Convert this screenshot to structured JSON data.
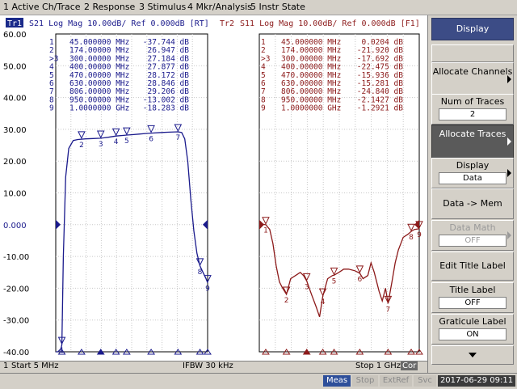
{
  "menu": [
    "1 Active Ch/Trace",
    "2 Response",
    "3 Stimulus",
    "4 Mkr/Analysis",
    "5 Instr State"
  ],
  "trace1": {
    "tag": "Tr1",
    "header": "S21  Log Mag 10.00dB/ Ref 0.000dB [RT]",
    "color": "#1a1a8c",
    "ref_label": "0.000",
    "yticks": [
      "60.00",
      "50.00",
      "40.00",
      "30.00",
      "20.00",
      "10.00",
      "0.000",
      "-10.00",
      "-20.00",
      "-30.00",
      "-40.00"
    ],
    "marker_table": [
      {
        "n": "1",
        "freq": "45.000000 MHz",
        "val": "-37.744 dB"
      },
      {
        "n": "2",
        "freq": "174.00000 MHz",
        "val": "26.947 dB"
      },
      {
        "n": ">3",
        "freq": "300.00000 MHz",
        "val": "27.184 dB"
      },
      {
        "n": "4",
        "freq": "400.00000 MHz",
        "val": "27.877 dB"
      },
      {
        "n": "5",
        "freq": "470.00000 MHz",
        "val": "28.172 dB"
      },
      {
        "n": "6",
        "freq": "630.00000 MHz",
        "val": "28.846 dB"
      },
      {
        "n": "7",
        "freq": "806.00000 MHz",
        "val": "29.206 dB"
      },
      {
        "n": "8",
        "freq": "950.00000 MHz",
        "val": "-13.002 dB"
      },
      {
        "n": "9",
        "freq": "1.0000000 GHz",
        "val": "-18.283 dB"
      }
    ]
  },
  "trace2": {
    "tag": "Tr2",
    "header": "S11  Log Mag 10.00dB/ Ref 0.000dB [F1]",
    "color": "#8c1a1a",
    "marker_table": [
      {
        "n": "1",
        "freq": "45.000000 MHz",
        "val": "0.0204 dB"
      },
      {
        "n": "2",
        "freq": "174.00000 MHz",
        "val": "-21.920 dB"
      },
      {
        "n": ">3",
        "freq": "300.00000 MHz",
        "val": "-17.692 dB"
      },
      {
        "n": "4",
        "freq": "400.00000 MHz",
        "val": "-22.475 dB"
      },
      {
        "n": "5",
        "freq": "470.00000 MHz",
        "val": "-15.936 dB"
      },
      {
        "n": "6",
        "freq": "630.00000 MHz",
        "val": "-15.281 dB"
      },
      {
        "n": "7",
        "freq": "806.00000 MHz",
        "val": "-24.840 dB"
      },
      {
        "n": "8",
        "freq": "950.00000 MHz",
        "val": "-2.1427 dB"
      },
      {
        "n": "9",
        "freq": "1.0000000 GHz",
        "val": "-1.2921 dB"
      }
    ]
  },
  "status": {
    "channel": "1",
    "start": "Start 5 MHz",
    "ifbw": "IFBW 30 kHz",
    "stop": "Stop 1 GHz",
    "cor": "Cor"
  },
  "bottom": {
    "meas": "Meas",
    "stop": "Stop",
    "extref": "ExtRef",
    "svc": "Svc",
    "datetime": "2017-06-29 09:11"
  },
  "softkeys": {
    "title": "Display",
    "allocate_channels": "Allocate Channels",
    "num_traces_label": "Num of Traces",
    "num_traces_value": "2",
    "allocate_traces": "Allocate Traces",
    "display_label": "Display",
    "display_value": "Data",
    "data_mem": "Data -> Mem",
    "data_math_label": "Data Math",
    "data_math_value": "OFF",
    "edit_title": "Edit Title Label",
    "title_label": "Title Label",
    "title_label_value": "OFF",
    "graticule_label": "Graticule Label",
    "graticule_value": "ON"
  },
  "chart_data": [
    {
      "type": "line",
      "title": "S21  Log Mag 10.00dB/ Ref 0.000dB",
      "xlabel": "",
      "ylabel": "",
      "xlim": [
        5,
        1000
      ],
      "ylim": [
        -40,
        60
      ],
      "grid": true,
      "series": [
        {
          "x": [
            5,
            20,
            40,
            45,
            55,
            70,
            90,
            120,
            150,
            174,
            200,
            250,
            300,
            350,
            400,
            450,
            470,
            500,
            550,
            600,
            630,
            700,
            750,
            806,
            830,
            850,
            870,
            890,
            910,
            930,
            950,
            970,
            990,
            1000
          ],
          "y": [
            -40,
            -40,
            -39,
            -37.7,
            -10,
            15,
            24,
            26.5,
            26.8,
            26.9,
            27,
            27.1,
            27.2,
            27.5,
            27.9,
            28.1,
            28.2,
            28.3,
            28.5,
            28.7,
            28.8,
            29,
            29.1,
            29.2,
            29,
            27,
            20,
            8,
            -2,
            -9,
            -13,
            -15,
            -17,
            -18.3
          ]
        }
      ],
      "markers": [
        {
          "n": "1",
          "x": 45,
          "y": -37.744
        },
        {
          "n": "2",
          "x": 174,
          "y": 26.947
        },
        {
          "n": "3",
          "x": 300,
          "y": 27.184
        },
        {
          "n": "4",
          "x": 400,
          "y": 27.877
        },
        {
          "n": "5",
          "x": 470,
          "y": 28.172
        },
        {
          "n": "6",
          "x": 630,
          "y": 28.846
        },
        {
          "n": "7",
          "x": 806,
          "y": 29.206
        },
        {
          "n": "8",
          "x": 950,
          "y": -13.002
        },
        {
          "n": "9",
          "x": 1000,
          "y": -18.283
        }
      ]
    },
    {
      "type": "line",
      "title": "S11  Log Mag 10.00dB/ Ref 0.000dB",
      "xlabel": "",
      "ylabel": "",
      "xlim": [
        5,
        1000
      ],
      "ylim": [
        -40,
        60
      ],
      "grid": true,
      "series": [
        {
          "x": [
            5,
            20,
            45,
            70,
            90,
            110,
            130,
            150,
            174,
            200,
            230,
            260,
            280,
            300,
            330,
            360,
            380,
            400,
            430,
            460,
            470,
            500,
            530,
            560,
            600,
            630,
            650,
            680,
            700,
            720,
            750,
            770,
            790,
            806,
            830,
            850,
            870,
            900,
            930,
            950,
            970,
            1000
          ],
          "y": [
            0,
            0.2,
            0,
            -1.5,
            -6,
            -13,
            -18,
            -20,
            -21.9,
            -17,
            -16,
            -15,
            -16,
            -17.7,
            -22,
            -26,
            -29,
            -22.5,
            -17,
            -16,
            -15.9,
            -15,
            -14,
            -14,
            -14.5,
            -15.3,
            -17,
            -16,
            -12,
            -15,
            -21,
            -24,
            -20,
            -24.8,
            -18,
            -12,
            -8,
            -4,
            -3,
            -2.1,
            -1.5,
            -1.3
          ]
        }
      ],
      "markers": [
        {
          "n": "1",
          "x": 45,
          "y": 0.0204
        },
        {
          "n": "2",
          "x": 174,
          "y": -21.92
        },
        {
          "n": "3",
          "x": 300,
          "y": -17.692
        },
        {
          "n": "4",
          "x": 400,
          "y": -22.475
        },
        {
          "n": "5",
          "x": 470,
          "y": -15.936
        },
        {
          "n": "6",
          "x": 630,
          "y": -15.281
        },
        {
          "n": "7",
          "x": 806,
          "y": -24.84
        },
        {
          "n": "8",
          "x": 950,
          "y": -2.1427
        },
        {
          "n": "9",
          "x": 1000,
          "y": -1.2921
        }
      ]
    }
  ]
}
